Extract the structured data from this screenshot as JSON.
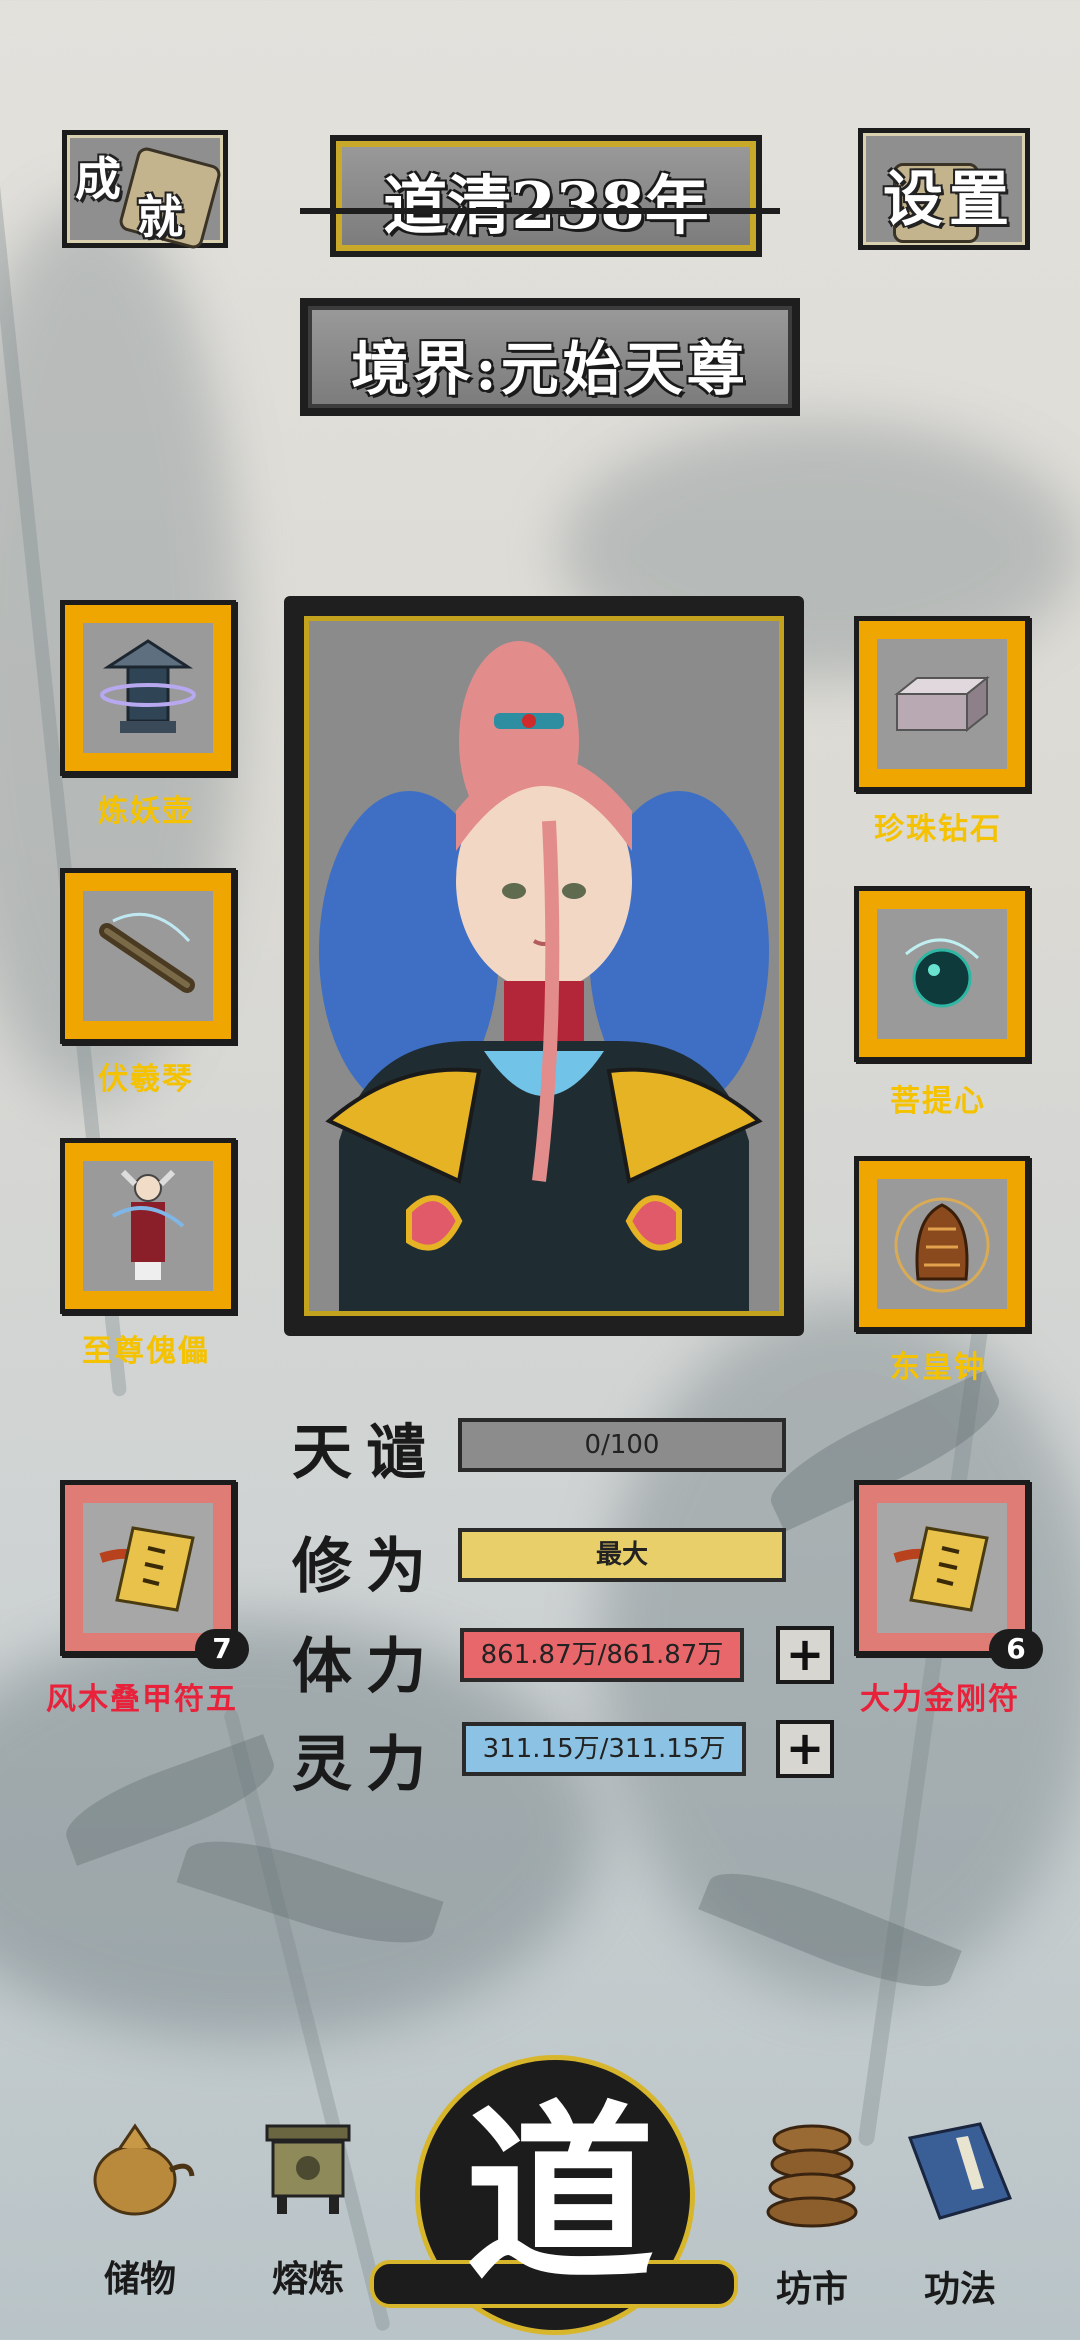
{
  "header": {
    "achievements_label": "成就",
    "year_title": "道清238年",
    "settings_label": "设置",
    "realm_text": "境界:元始天尊"
  },
  "left_items": [
    {
      "label": "炼妖壶",
      "icon": "pagoda-icon"
    },
    {
      "label": "伏羲琴",
      "icon": "zither-icon"
    },
    {
      "label": "至尊傀儡",
      "icon": "puppet-icon"
    }
  ],
  "right_items": [
    {
      "label": "珍珠钻石",
      "icon": "diamond-block-icon"
    },
    {
      "label": "菩提心",
      "icon": "orb-icon"
    },
    {
      "label": "东皇钟",
      "icon": "bell-icon"
    }
  ],
  "talismans": {
    "left": {
      "label": "风木叠甲符五",
      "count": "7"
    },
    "right": {
      "label": "大力金刚符",
      "count": "6"
    }
  },
  "stats": {
    "tianqian": {
      "label": "天谴",
      "value": "0/100",
      "fill": 0,
      "color": "#8c8c8c"
    },
    "xiuwei": {
      "label": "修为",
      "value": "最大",
      "fill": 1.0,
      "color": "#e8cf6a"
    },
    "tili": {
      "label": "体力",
      "value": "861.87万/861.87万",
      "fill": 1.0,
      "color": "#e8676b"
    },
    "lingli": {
      "label": "灵力",
      "value": "311.15万/311.15万",
      "fill": 1.0,
      "color": "#8cc2e4"
    },
    "plus_symbol": "+"
  },
  "nav": {
    "storage": "储物",
    "refine": "熔炼",
    "center": "道",
    "market": "坊市",
    "skills": "功法"
  },
  "colors": {
    "slot_gold": "#f0a600",
    "slot_red": "#e07c76",
    "label_gold": "#f4c200",
    "label_red": "#e8223a"
  }
}
